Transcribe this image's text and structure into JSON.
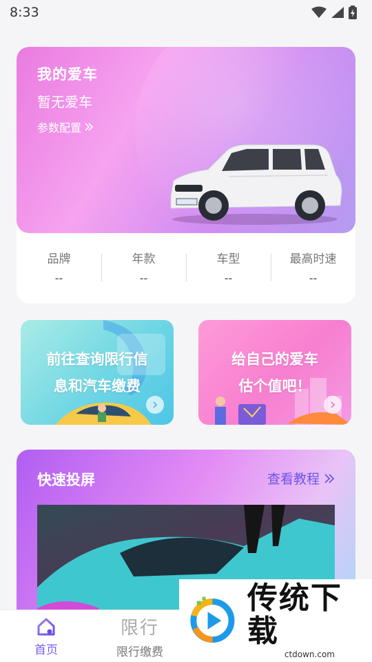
{
  "status_bar": {
    "time": "8:33"
  },
  "car_card": {
    "title": "我的爱车",
    "subtitle": "暂无爱车",
    "config_label": "参数配置",
    "stats": [
      {
        "label": "品牌",
        "value": "--"
      },
      {
        "label": "年款",
        "value": "--"
      },
      {
        "label": "车型",
        "value": "--"
      },
      {
        "label": "最高时速",
        "value": "--"
      }
    ]
  },
  "features": [
    {
      "line1": "前往查询限行信",
      "line2": "息和汽车缴费"
    },
    {
      "line1": "给自己的爱车",
      "line2": "估个值吧！"
    }
  ],
  "cast": {
    "title": "快速投屏",
    "tutorial_label": "查看教程"
  },
  "nav": {
    "home_label": "首页",
    "limit_icon_text": "限行",
    "limit_label": "限行缴费"
  },
  "watermark": {
    "brand": "传统下载",
    "url": "ctdown.com"
  },
  "colors": {
    "accent": "#7b5cf0",
    "tutorial": "#6b55e8"
  }
}
